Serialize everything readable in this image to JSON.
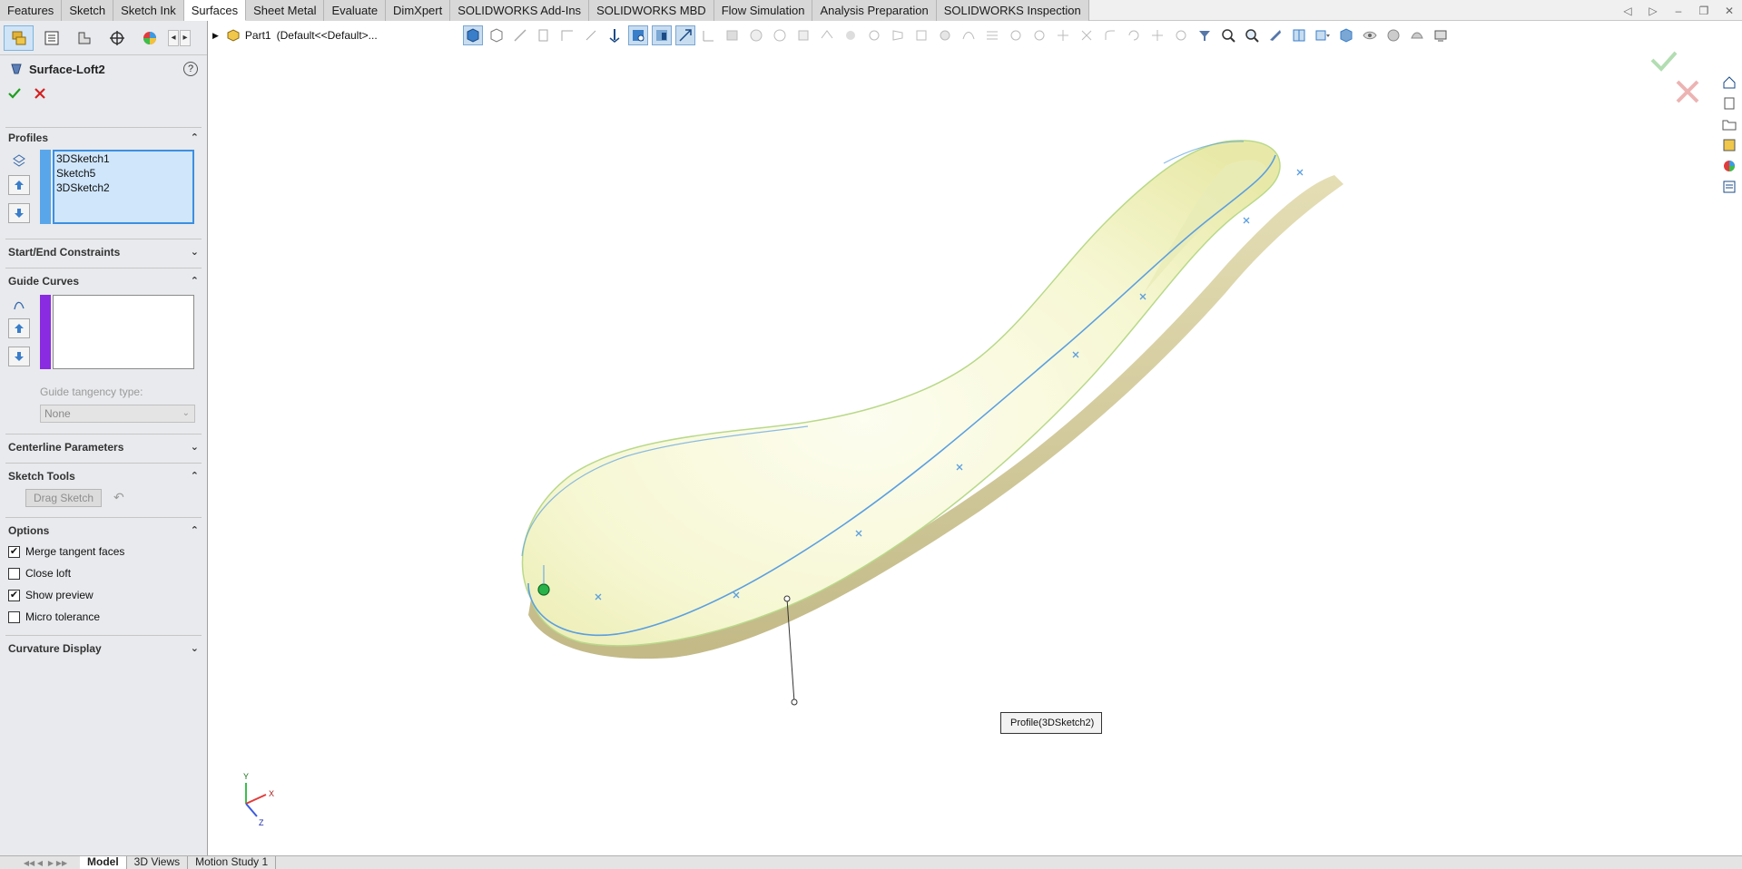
{
  "tabs": [
    {
      "label": "Features",
      "active": false
    },
    {
      "label": "Sketch",
      "active": false
    },
    {
      "label": "Sketch Ink",
      "active": false
    },
    {
      "label": "Surfaces",
      "active": true
    },
    {
      "label": "Sheet Metal",
      "active": false
    },
    {
      "label": "Evaluate",
      "active": false
    },
    {
      "label": "DimXpert",
      "active": false
    },
    {
      "label": "SOLIDWORKS Add-Ins",
      "active": false
    },
    {
      "label": "SOLIDWORKS MBD",
      "active": false
    },
    {
      "label": "Flow Simulation",
      "active": false
    },
    {
      "label": "Analysis Preparation",
      "active": false
    },
    {
      "label": "SOLIDWORKS Inspection",
      "active": false
    }
  ],
  "breadcrumb": {
    "part": "Part1",
    "config": "(Default<<Default>..."
  },
  "feature": {
    "title": "Surface-Loft2",
    "help": "?"
  },
  "sections": {
    "profiles": {
      "title": "Profiles",
      "items": [
        "3DSketch1",
        "Sketch5",
        "3DSketch2"
      ]
    },
    "start_end": {
      "title": "Start/End Constraints"
    },
    "guide_curves": {
      "title": "Guide Curves",
      "tangency_label": "Guide tangency type:",
      "tangency_value": "None"
    },
    "centerline": {
      "title": "Centerline Parameters"
    },
    "sketch_tools": {
      "title": "Sketch Tools",
      "drag_button": "Drag Sketch"
    },
    "options": {
      "title": "Options",
      "merge_tangent": {
        "label": "Merge tangent faces",
        "checked": true
      },
      "close_loft": {
        "label": "Close loft",
        "checked": false
      },
      "show_preview": {
        "label": "Show preview",
        "checked": true
      },
      "micro_tolerance": {
        "label": "Micro tolerance",
        "checked": false
      }
    },
    "curvature": {
      "title": "Curvature Display"
    }
  },
  "viewport": {
    "tooltip": "Profile(3DSketch2)",
    "axis_labels": {
      "x": "X",
      "y": "Y",
      "z": "Z"
    }
  },
  "bottom_tabs": [
    {
      "label": "Model",
      "active": true
    },
    {
      "label": "3D Views",
      "active": false
    },
    {
      "label": "Motion Study 1",
      "active": false
    }
  ],
  "colors": {
    "accent": "#3d8fe0",
    "profile_bar": "#5aa6ea",
    "guide_bar": "#8a2be2",
    "surface": "#f6f7d2",
    "curve": "#5b9fe0",
    "ok_green": "#1f9e1f",
    "cancel_red": "#d42020"
  }
}
